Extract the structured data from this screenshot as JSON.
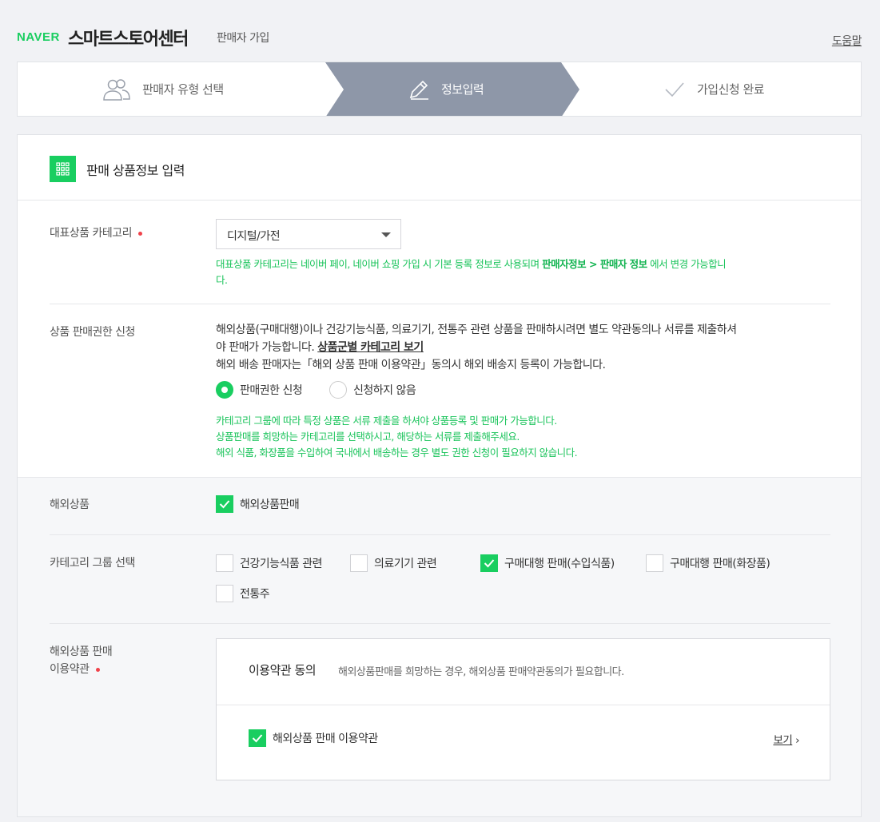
{
  "header": {
    "brand": "NAVER",
    "title": "스마트스토어센터",
    "subtitle": "판매자 가입",
    "help": "도움말"
  },
  "steps": [
    {
      "label": "판매자 유형 선택",
      "icon": "users-icon",
      "active": false
    },
    {
      "label": "정보입력",
      "icon": "pencil-icon",
      "active": true
    },
    {
      "label": "가입신청 완료",
      "icon": "check-icon",
      "active": false
    }
  ],
  "colors": {
    "accent": "#19ce60",
    "step_active": "#8e97a8",
    "required": "#f0424a"
  },
  "section": {
    "title": "판매 상품정보 입력",
    "icon": "grid-icon"
  },
  "category": {
    "label": "대표상품 카테고리",
    "selected": "디지털/가전",
    "note_pre": "대표상품 카테고리는 네이버 페이, 네이버 쇼핑 가입 시 기본 등록 정보로 사용되며 ",
    "note_bold": "판매자정보 > 판매자 정보",
    "note_post": " 에서 변경 가능합니",
    "note_wrap": "다."
  },
  "permission": {
    "label": "상품 판매권한 신청",
    "text_line1": "해외상품(구매대행)이나 건강기능식품, 의료기기, 전통주 관련 상품을 판매하시려면 별도 약관동의나 서류를 제출하셔",
    "text_line2_pre": "야 판매가 가능합니다. ",
    "text_line2_link": "상품군별 카테고리 보기",
    "text_line3": "해외 배송 판매자는「해외 상품 판매 이용약관」동의시 해외 배송지 등록이 가능합니다.",
    "option_apply": "판매권한 신청",
    "option_none": "신청하지 않음",
    "selected": "판매권한 신청",
    "notes": [
      "카테고리 그룹에 따라 특정 상품은 서류 제출을 하셔야 상품등록 및 판매가 가능합니다.",
      "상품판매를 희망하는 카테고리를 선택하시고, 해당하는 서류를 제출해주세요.",
      "해외 식품, 화장품을 수입하여 국내에서 배송하는 경우 별도 권한 신청이 필요하지 않습니다."
    ]
  },
  "overseas": {
    "label": "해외상품",
    "checkbox_label": "해외상품판매",
    "checked": true
  },
  "category_group": {
    "label": "카테고리 그룹 선택",
    "options": [
      {
        "label": "건강기능식품 관련",
        "checked": false
      },
      {
        "label": "의료기기 관련",
        "checked": false
      },
      {
        "label": "구매대행 판매(수입식품)",
        "checked": true
      },
      {
        "label": "구매대행 판매(화장품)",
        "checked": false
      },
      {
        "label": "전통주",
        "checked": false
      }
    ]
  },
  "terms": {
    "label_line1": "해외상품 판매",
    "label_line2": "이용약관",
    "title": "이용약관 동의",
    "desc": "해외상품판매를 희망하는 경우, 해외상품 판매약관동의가 필요합니다.",
    "item_label": "해외상품 판매 이용약관",
    "item_checked": true,
    "view": "보기",
    "view_arrow": "›"
  }
}
